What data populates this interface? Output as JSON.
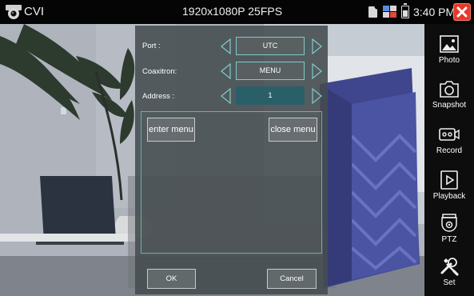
{
  "status_bar": {
    "app_title": "CVI",
    "resolution": "1920x1080P 25FPS",
    "time": "3:40 PM",
    "icons": [
      "camera-logo-icon",
      "sd-card-icon",
      "network-icon",
      "battery-icon",
      "close-icon"
    ],
    "close_color": "#e5392a"
  },
  "sidebar": {
    "items": [
      {
        "label": "Photo",
        "icon": "photo-icon"
      },
      {
        "label": "Snapshot",
        "icon": "snapshot-icon"
      },
      {
        "label": "Record",
        "icon": "record-icon"
      },
      {
        "label": "Playback",
        "icon": "playback-icon"
      },
      {
        "label": "PTZ",
        "icon": "ptz-icon"
      },
      {
        "label": "Set",
        "icon": "settings-tools-icon"
      }
    ]
  },
  "dialog": {
    "port": {
      "label": "Port :",
      "value": "UTC"
    },
    "coaxitron": {
      "label": "Coaxitron:",
      "value": "MENU"
    },
    "address": {
      "label": "Address :",
      "value": "1"
    },
    "enter_menu_label": "enter menu",
    "close_menu_label": "close menu",
    "ok_label": "OK",
    "cancel_label": "Cancel",
    "accent_color": "#7ecbc9"
  }
}
